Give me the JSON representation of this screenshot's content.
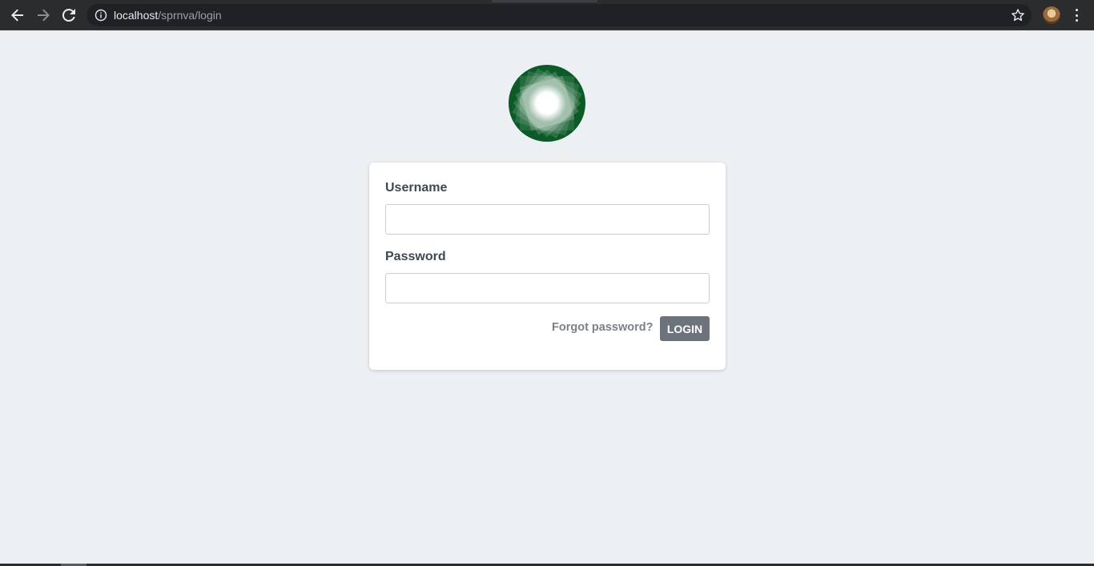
{
  "browser": {
    "url_host": "localhost",
    "url_path": "/sprnva/login",
    "icons": {
      "back": "back-arrow-icon",
      "forward": "forward-arrow-icon",
      "reload": "reload-icon",
      "info": "info-icon",
      "bookmark": "star-icon",
      "profile": "avatar",
      "menu": "menu-dots-icon"
    }
  },
  "page": {
    "logo": "app-logo",
    "brand_color": "#0b5a27",
    "background": "#edf0f3"
  },
  "login_form": {
    "username_label": "Username",
    "username_value": "",
    "password_label": "Password",
    "password_value": "",
    "forgot_password_link": "Forgot password?",
    "login_button": "LOGIN"
  }
}
